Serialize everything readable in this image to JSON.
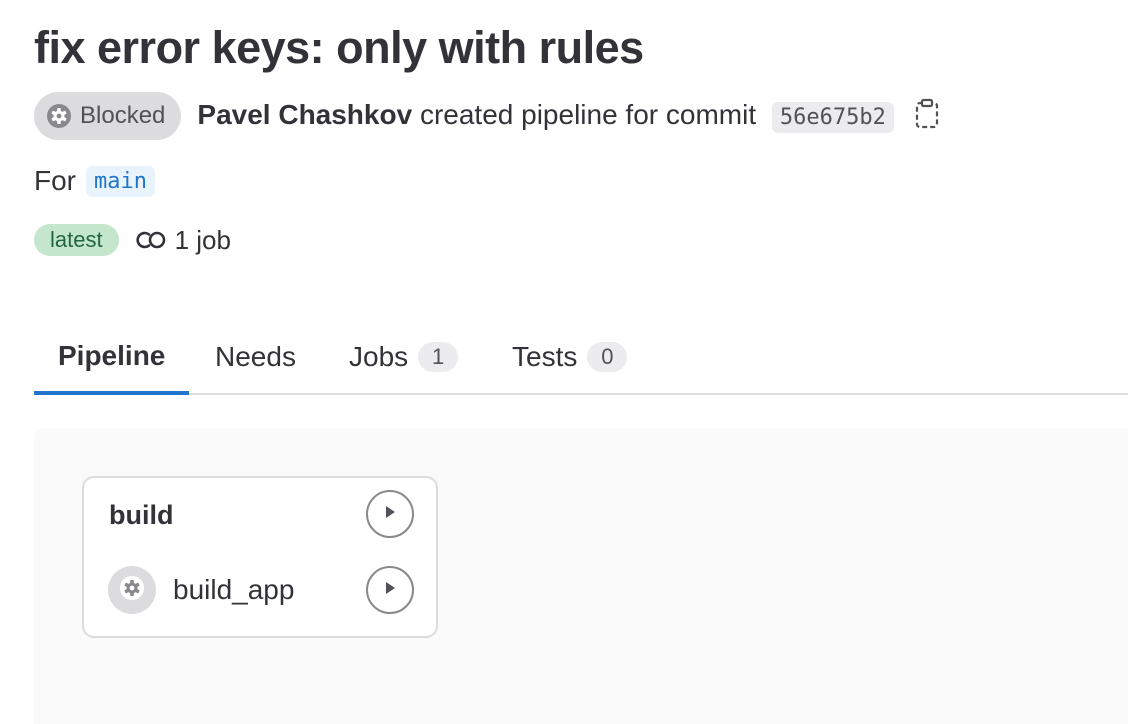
{
  "pipeline": {
    "title": "fix error keys: only with rules",
    "status": "Blocked",
    "author": "Pavel Chashkov",
    "action_text": "created pipeline for commit",
    "commit_sha": "56e675b2",
    "for_label": "For",
    "ref": "main",
    "badge": "latest",
    "job_count": "1 job"
  },
  "tabs": [
    {
      "label": "Pipeline",
      "count": null,
      "active": true
    },
    {
      "label": "Needs",
      "count": null,
      "active": false
    },
    {
      "label": "Jobs",
      "count": "1",
      "active": false
    },
    {
      "label": "Tests",
      "count": "0",
      "active": false
    }
  ],
  "stage": {
    "name": "build",
    "jobs": [
      {
        "name": "build_app",
        "status": "manual"
      }
    ]
  },
  "icons": {
    "status": "gear-icon",
    "copy": "clipboard-icon",
    "job_count": "pipeline-icon",
    "play": "play-icon"
  },
  "colors": {
    "accent": "#1f75cb",
    "latest_bg": "#c3e6cd",
    "latest_text": "#24663b",
    "blocked_bg": "#dcdcde"
  }
}
